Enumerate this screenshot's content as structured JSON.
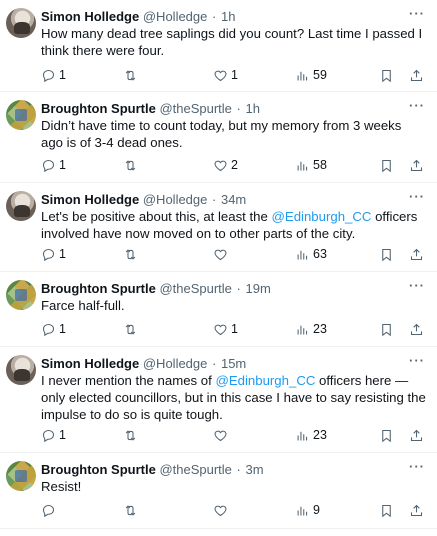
{
  "tweets": [
    {
      "author": "Simon Holledge",
      "handle": "@Holledge",
      "time": "1h",
      "text_parts": [
        "How many dead tree saplings did you count? Last time I passed I think there were four."
      ],
      "replies": "1",
      "retweets": "",
      "likes": "1",
      "views": "59"
    },
    {
      "author": "Broughton Spurtle",
      "handle": "@theSpurtle",
      "time": "1h",
      "text_parts": [
        "Didn’t have time to count today, but my memory from 3 weeks ago is of 3-4 dead ones."
      ],
      "replies": "1",
      "retweets": "",
      "likes": "2",
      "views": "58"
    },
    {
      "author": "Simon Holledge",
      "handle": "@Holledge",
      "time": "34m",
      "text_parts": [
        "Let's be positive about this, at least the ",
        "@Edinburgh_CC",
        " officers involved have now moved on to other parts of the city."
      ],
      "replies": "1",
      "retweets": "",
      "likes": "",
      "views": "63"
    },
    {
      "author": "Broughton Spurtle",
      "handle": "@theSpurtle",
      "time": "19m",
      "text_parts": [
        "Farce half-full."
      ],
      "replies": "1",
      "retweets": "",
      "likes": "1",
      "views": "23"
    },
    {
      "author": "Simon Holledge",
      "handle": "@Holledge",
      "time": "15m",
      "text_parts": [
        "I never mention the names of ",
        "@Edinburgh_CC",
        " officers here — only elected councillors, but in this case I have to say resisting the impulse to do so is quite tough."
      ],
      "replies": "1",
      "retweets": "",
      "likes": "",
      "views": "23"
    },
    {
      "author": "Broughton Spurtle",
      "handle": "@theSpurtle",
      "time": "3m",
      "text_parts": [
        "Resist!"
      ],
      "replies": "",
      "retweets": "",
      "likes": "",
      "views": "9"
    }
  ],
  "icons": {
    "reply": "reply-icon",
    "retweet": "retweet-icon",
    "like": "heart-icon",
    "views": "views-icon",
    "bookmark": "bookmark-icon",
    "share": "share-icon",
    "more": "more-icon"
  },
  "more_glyph": "···",
  "separator": "·",
  "colors": {
    "link": "#1d9bf0",
    "secondary": "#536471",
    "text": "#0f1419"
  }
}
